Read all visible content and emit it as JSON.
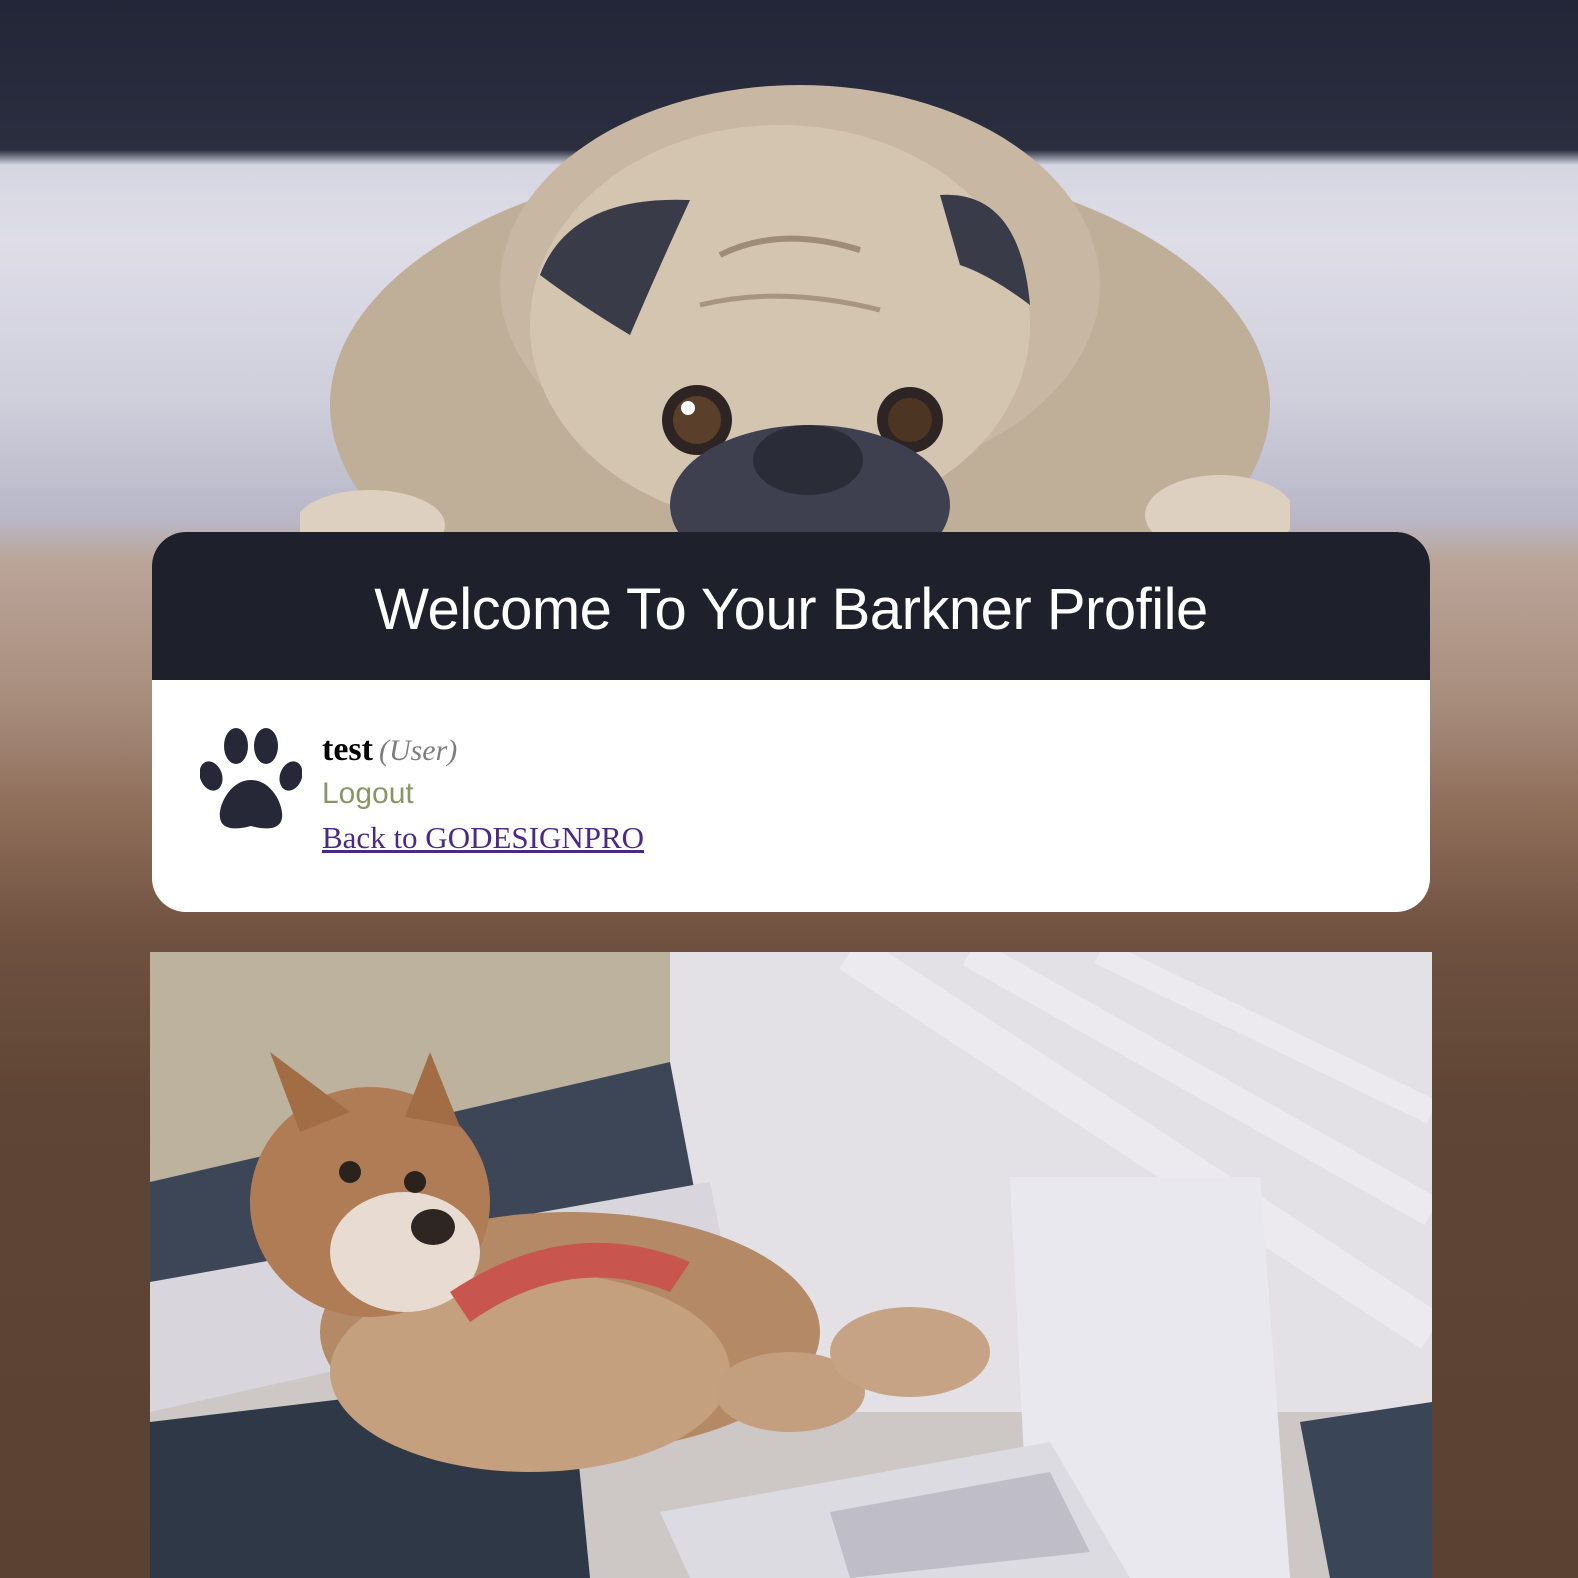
{
  "hero": {
    "image": "pug-lying-on-floor-photo"
  },
  "profile_card": {
    "title": "Welcome To Your Barkner Profile",
    "avatar_icon": "paw-icon",
    "username": "test",
    "role": "(User)",
    "logout_label": "Logout",
    "back_link_label": "Back to GODESIGNPRO"
  },
  "gallery": {
    "image": "shiba-dog-typing-on-laptop-photo"
  },
  "colors": {
    "header_bg": "#1e202b",
    "card_bg": "#ffffff",
    "logout": "#8b9668",
    "link": "#4a2a86",
    "paw": "#262838"
  }
}
